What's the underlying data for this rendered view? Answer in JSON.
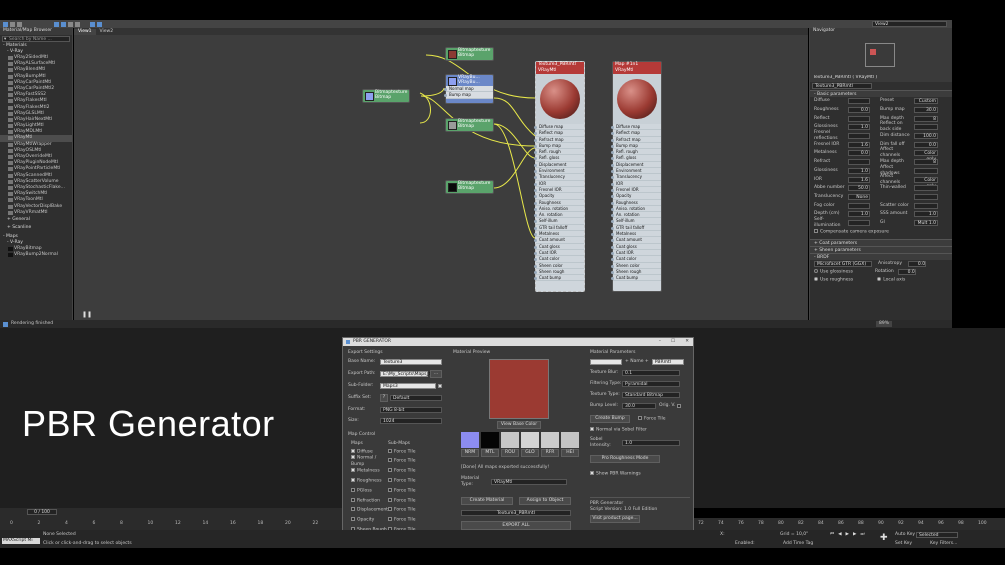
{
  "colors": {
    "accent": "#5a8fd0",
    "material_red": "#9b3a32",
    "title_white": "#ffffff"
  },
  "top_bar": {
    "view_dropdown": "View2"
  },
  "browser": {
    "title": "Material/Map Browser",
    "search_placeholder": "Search by Name ...",
    "materials_header": "- Materials",
    "vray_header": "- V-Ray",
    "materials": [
      "VRay2SidedMtl",
      "VRayALSurfaceMtl",
      "VRayBlendMtl",
      "VRayBumpMtl",
      "VRayCarPaintMtl",
      "VRayCarPaintMtl2",
      "VRayFastSSS2",
      "VRayFlakesMtl",
      "VRayFlakesMtl2",
      "VRayGLSLMtl",
      "VRayHairNextMtl",
      "VRayLightMtl",
      "VRayMDLMtl",
      "VRayMtl",
      "VRayMtlWrapper",
      "VRayOSLMtl",
      "VRayOverrideMtl",
      "VRayPluginNodeMtl",
      "VRayPointParticleMtl",
      "VRayScannedMtl",
      "VRayScatterVolume",
      "VRayStochasticFlake...",
      "VRaySwitchMtl",
      "VRayToonMtl",
      "VRayVectorDisplBake",
      "VRayVRmatMtl"
    ],
    "general": "+ General",
    "scanline": "+ Scanline",
    "maps_header": "- Maps",
    "maps_vray": "- V-Ray",
    "maps": [
      "VRayBitmap",
      "VRayBump2Normal"
    ]
  },
  "view_tabs": [
    "View1",
    "View2"
  ],
  "nodes": {
    "bitmap_a": {
      "title": "Bitmaptexture",
      "sub": "Bitmap"
    },
    "bitmap_b": {
      "title": "Bitmaptexture",
      "sub": "Bitmap"
    },
    "bitmap_c": {
      "title": "Bitmaptexture",
      "sub": "Bitmap"
    },
    "bitmap_d": {
      "title": "Bitmaptexture",
      "sub": "Bitmap"
    },
    "bitmap_e": {
      "title": "Bitmaptexture",
      "sub": "Bitmap"
    },
    "bump": {
      "title": "VRayBu...",
      "sub": "VRayBu...",
      "slots": [
        "Normal map",
        "Bump map"
      ]
    },
    "material1": {
      "title": "Texture3_PBRmtl",
      "sub": "VRayMtl"
    },
    "material2": {
      "title": "Map #1n1",
      "sub": "VRayMtl"
    },
    "mtl_slots": [
      "Diffuse map",
      "Reflect map",
      "Refract map",
      "Bump map",
      "Refl. rough",
      "Refl. gloss",
      "Displacement",
      "Environment",
      "Translucency",
      "IOR",
      "Fresnel IOR",
      "Opacity",
      "Roughness",
      "Aniso. rotation",
      "An. rotation",
      "Self-illum",
      "GTR tail falloff",
      "Metalness",
      "Coat amount",
      "Coat gloss",
      "Coat IOR",
      "Coat color",
      "Sheen color",
      "Sheen rough",
      "Coat bump"
    ],
    "mtl_slots2": [
      "Diffuse map",
      "Reflect map",
      "Refract map",
      "Bump map",
      "Refl. rough",
      "Refl. gloss",
      "Displacement",
      "Environment",
      "Translucency",
      "IOR",
      "Fresnel IOR",
      "Opacity",
      "Roughness",
      "Aniso. rotation",
      "An. rotation",
      "Self-illum",
      "GTR tail falloff",
      "Metalness",
      "Coat amount",
      "Coat gloss",
      "Coat IOR",
      "Coat color",
      "Sheen color",
      "Sheen rough",
      "Coat bump"
    ]
  },
  "navigator": {
    "title": "Navigator"
  },
  "props": {
    "title": "Texture3_PBRmtl ( VRayMtl )",
    "name_field": "Texture3_PBRmtl",
    "basic_params": "- Basic parameters",
    "rows": [
      {
        "l1": "Diffuse",
        "v1": "",
        "l2": "Preset",
        "v2": "Custom"
      },
      {
        "l1": "Roughness",
        "v1": "0.0",
        "l2": "Bump map",
        "v2": "30.0"
      },
      {
        "l1": "Reflect",
        "v1": "",
        "l2": "Max depth",
        "v2": "8"
      },
      {
        "l1": "Glossiness",
        "v1": "1.0",
        "l2": "Reflect on back side",
        "v2": ""
      },
      {
        "l1": "Fresnel reflections",
        "v1": "",
        "l2": "Dim distance",
        "v2": "100.0"
      },
      {
        "l1": "Fresnel IOR",
        "v1": "1.6",
        "l2": "Dim fall off",
        "v2": "0.0"
      },
      {
        "l1": "Metalness",
        "v1": "0.0",
        "l2": "Affect channels",
        "v2": "Color only"
      },
      {
        "l1": "Refract",
        "v1": "",
        "l2": "Max depth",
        "v2": "8"
      },
      {
        "l1": "Glossiness",
        "v1": "1.0",
        "l2": "Affect shadows",
        "v2": ""
      },
      {
        "l1": "IOR",
        "v1": "1.6",
        "l2": "Affect channels",
        "v2": "Color only"
      },
      {
        "l1": "Abbe number",
        "v1": "50.0",
        "l2": "Thin-walled",
        "v2": ""
      },
      {
        "l1": "Translucency",
        "v1": "None",
        "l2": "",
        "v2": ""
      },
      {
        "l1": "Fog color",
        "v1": "",
        "l2": "Scatter color",
        "v2": ""
      },
      {
        "l1": "Depth (cm)",
        "v1": "1.0",
        "l2": "SSS amount",
        "v2": "1.0"
      },
      {
        "l1": "Self-illumination",
        "v1": "",
        "l2": "GI",
        "v2": "Mult 1.0"
      }
    ],
    "compensate": "Compensate camera exposure",
    "coat": "+ Coat parameters",
    "sheen": "+ Sheen parameters",
    "brdf": "- BRDF",
    "brdf_type": "Microfacet GTR (GGX)",
    "anisotropy": "Anisotropy",
    "anisotropy_v": "0.0",
    "use_gloss": "Use glossiness",
    "rotation": "Rotation",
    "rotation_v": "0.0",
    "use_rough": "Use roughness",
    "local_axis": "Local axis"
  },
  "status_top": {
    "text": "Rendering finished",
    "zoom": "89%"
  },
  "big_title": "PBR Generator",
  "pbr": {
    "title": "PBR GENERATOR",
    "export_settings": "Export Settings",
    "base_name_label": "Base Name:",
    "base_name": "Texture3",
    "export_path_label": "Export Path:",
    "export_path": "E:\\My_Scripts\\Maps_tx",
    "sub_folder_label": "Sub-Folder:",
    "sub_folder": "Maps3",
    "suffix_label": "Suffix Set:",
    "suffix": "Default",
    "format_label": "Format:",
    "format": "PNG 8-bit",
    "size_label": "Size:",
    "size": "1024",
    "map_control": "Map Control",
    "maps_label": "Maps",
    "submaps_label": "Sub-Maps",
    "maps": [
      "Diffuse",
      "Normal / Bump",
      "Metalness",
      "Roughness",
      "PGloss",
      "Refraction",
      "Displacement",
      "Opacity",
      "Sheen Rough"
    ],
    "force_tile": "Force Tile",
    "material_preview": "Material Preview",
    "view_base_color": "View Base Color",
    "thumbs": [
      "NRM",
      "MTL",
      "ROU",
      "GLO",
      "RFR",
      "HEI"
    ],
    "status_msg": "[Done] All maps exported successfully!",
    "material_type_label": "Material Type:",
    "material_type": "VRayMtl",
    "create_material": "Create Material",
    "assign_to_object": "Assign to Object",
    "material_name": "Texture3_PBRmtl",
    "export_all": "EXPORT ALL",
    "material_params": "Material Parameters",
    "name_prefix": "",
    "name_label": "+ Name +",
    "name_suffix": "PBRmtl",
    "tex_blur_label": "Texture Blur:",
    "tex_blur": "0.1",
    "filtering_label": "Filtering Type:",
    "filtering": "Pyramidal",
    "texture_type_label": "Texture Type:",
    "texture_type": "Standard Bitmap",
    "bump_level_label": "Bump Level:",
    "bump_level": "30.0",
    "orig_v": "Orig. V.",
    "create_bump": "Create Bump",
    "force_tile2": "Force Tile",
    "normal_via_sobel": "Normal via Sobel Filter",
    "sobel_label": "Sobel Intensity:",
    "sobel": "1.0",
    "pbr_roughness": "Pro Roughness Mode",
    "show_warnings": "Show PBR Warnings",
    "footer1": "PBR Generator",
    "footer2": "Script Version: 1.0 Full Edition",
    "visit": "Visit product page..."
  },
  "timeline": {
    "frame": "0 / 100",
    "ticks": [
      "0",
      "2",
      "4",
      "6",
      "8",
      "10",
      "12",
      "14",
      "16",
      "18",
      "20",
      "22"
    ],
    "ticks_right": [
      "72",
      "74",
      "76",
      "78",
      "80",
      "82",
      "84",
      "86",
      "88",
      "90",
      "92",
      "94",
      "96",
      "98",
      "100"
    ]
  },
  "bottom": {
    "maxscript": "MAXScript Mi",
    "none_selected": "None Selected",
    "hint": "Click or click-and-drag to select objects",
    "grid": "Grid = 10,0\"",
    "auto": "Auto Key",
    "selected": "Selected",
    "set_key": "Set Key",
    "key_filters": "Key Filters...",
    "add_time_tag": "Add Time Tag",
    "enabled": "Enabled:",
    "x_label": "X:",
    "y_label": "Y:",
    "z_label": "Z:"
  }
}
